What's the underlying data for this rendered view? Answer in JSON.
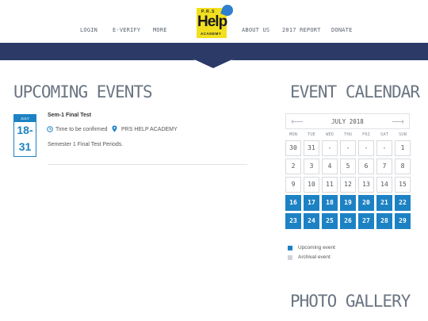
{
  "nav": {
    "login": "LOGIN",
    "everify": "E-VERIFY",
    "more": "MORE",
    "about": "ABOUT US",
    "report": "2017 REPORT",
    "donate": "DONATE"
  },
  "logo": {
    "prs": "P.R.S",
    "help": "Help",
    "academy": "ACADEMY"
  },
  "colors": {
    "band": "#2b3a67",
    "accent": "#1d82c4",
    "logo_yellow": "#f2e01f"
  },
  "upcoming": {
    "heading": "UPCOMING EVENTS",
    "event": {
      "month": "JULY",
      "day_start": "18-",
      "day_end": "31",
      "title": "Sem-1 Final Test",
      "time": "Time to be confirmed",
      "location": "PRS HELP ACADEMY",
      "description": "Semester 1 Final Test Periods."
    }
  },
  "calendar": {
    "heading": "EVENT CALENDAR",
    "month_title": "JULY 2018",
    "prev_icon": "arrow-left-icon",
    "next_icon": "arrow-right-icon",
    "weekdays": [
      "MON",
      "TUE",
      "WED",
      "THU",
      "FRI",
      "SAT",
      "SUN"
    ],
    "weeks": [
      [
        {
          "d": "30",
          "up": false
        },
        {
          "d": "31",
          "up": false
        },
        {
          "d": "-",
          "up": false
        },
        {
          "d": "-",
          "up": false
        },
        {
          "d": "-",
          "up": false
        },
        {
          "d": "-",
          "up": false
        },
        {
          "d": "1",
          "up": false
        }
      ],
      [
        {
          "d": "2",
          "up": false
        },
        {
          "d": "3",
          "up": false
        },
        {
          "d": "4",
          "up": false
        },
        {
          "d": "5",
          "up": false
        },
        {
          "d": "6",
          "up": false
        },
        {
          "d": "7",
          "up": false
        },
        {
          "d": "8",
          "up": false
        }
      ],
      [
        {
          "d": "9",
          "up": false
        },
        {
          "d": "10",
          "up": false
        },
        {
          "d": "11",
          "up": false
        },
        {
          "d": "12",
          "up": false
        },
        {
          "d": "13",
          "up": false
        },
        {
          "d": "14",
          "up": false
        },
        {
          "d": "15",
          "up": false
        }
      ],
      [
        {
          "d": "16",
          "up": true
        },
        {
          "d": "17",
          "up": true
        },
        {
          "d": "18",
          "up": true
        },
        {
          "d": "19",
          "up": true
        },
        {
          "d": "20",
          "up": true
        },
        {
          "d": "21",
          "up": true
        },
        {
          "d": "22",
          "up": true
        }
      ],
      [
        {
          "d": "23",
          "up": true
        },
        {
          "d": "24",
          "up": true
        },
        {
          "d": "25",
          "up": true
        },
        {
          "d": "26",
          "up": true
        },
        {
          "d": "27",
          "up": true
        },
        {
          "d": "28",
          "up": true
        },
        {
          "d": "29",
          "up": true
        }
      ]
    ],
    "legend": [
      {
        "label": "Upcoming event",
        "color": "#1d82c4"
      },
      {
        "label": "Archival event",
        "color": "#cfd3d8"
      }
    ]
  },
  "gallery": {
    "heading": "PHOTO GALLERY"
  }
}
